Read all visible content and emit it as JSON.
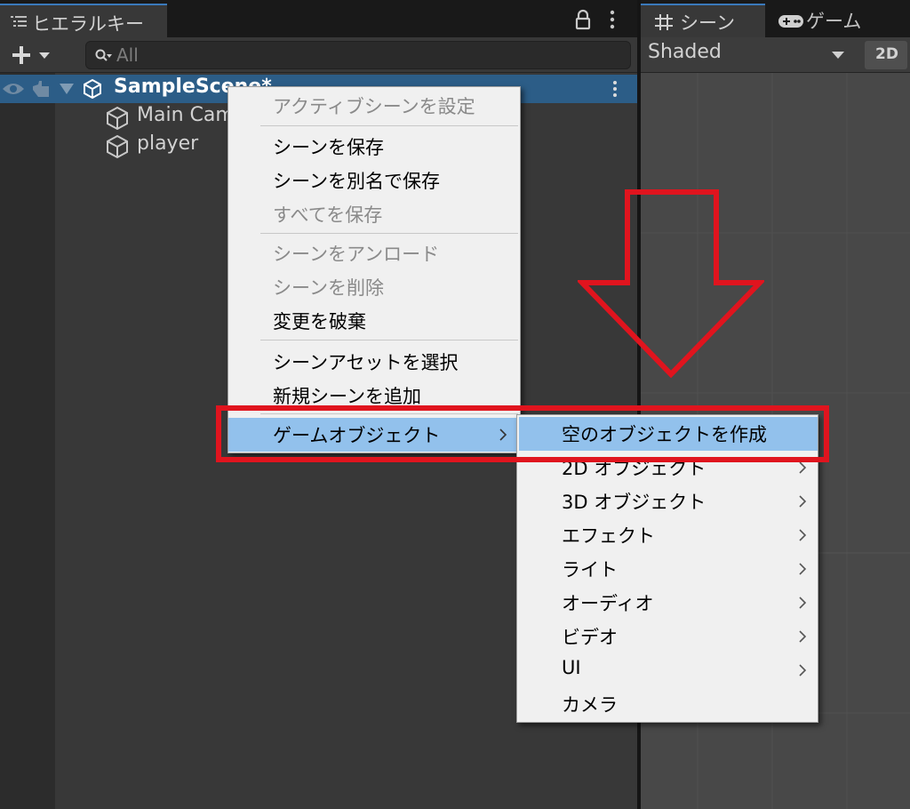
{
  "hierarchy": {
    "tab_label": "ヒエラルキー",
    "search": {
      "placeholder": "All",
      "value": ""
    },
    "scene_name": "SampleScene*",
    "objects": [
      {
        "label": "Main Camera"
      },
      {
        "label": "player"
      }
    ]
  },
  "scene_panel": {
    "tabs": [
      {
        "label": "シーン",
        "icon": "grid-icon"
      },
      {
        "label": "ゲーム",
        "icon": "gamepad-icon"
      }
    ],
    "shading_mode": "Shaded",
    "mode_2d_label": "2D"
  },
  "context_menu": {
    "items": [
      {
        "label": "アクティブシーンを設定",
        "enabled": false
      },
      {
        "label": "シーンを保存",
        "enabled": true
      },
      {
        "label": "シーンを別名で保存",
        "enabled": true
      },
      {
        "label": "すべてを保存",
        "enabled": false
      },
      {
        "label": "シーンをアンロード",
        "enabled": false
      },
      {
        "label": "シーンを削除",
        "enabled": false
      },
      {
        "label": "変更を破棄",
        "enabled": true
      },
      {
        "label": "シーンアセットを選択",
        "enabled": true
      },
      {
        "label": "新規シーンを追加",
        "enabled": true
      },
      {
        "label": "ゲームオブジェクト",
        "enabled": true,
        "highlighted": true,
        "has_submenu": true
      }
    ]
  },
  "submenu": {
    "items": [
      {
        "label": "空のオブジェクトを作成",
        "highlighted": true,
        "has_submenu": false
      },
      {
        "label": "2D オブジェクト",
        "has_submenu": true
      },
      {
        "label": "3D オブジェクト",
        "has_submenu": true
      },
      {
        "label": "エフェクト",
        "has_submenu": true
      },
      {
        "label": "ライト",
        "has_submenu": true
      },
      {
        "label": "オーディオ",
        "has_submenu": true
      },
      {
        "label": "ビデオ",
        "has_submenu": true
      },
      {
        "label": "UI",
        "has_submenu": true
      },
      {
        "label": "カメラ",
        "has_submenu": false
      }
    ]
  },
  "colors": {
    "annotation_red": "#e0141e",
    "selection_blue": "#2c5d87",
    "menu_highlight": "#92c1ec"
  }
}
